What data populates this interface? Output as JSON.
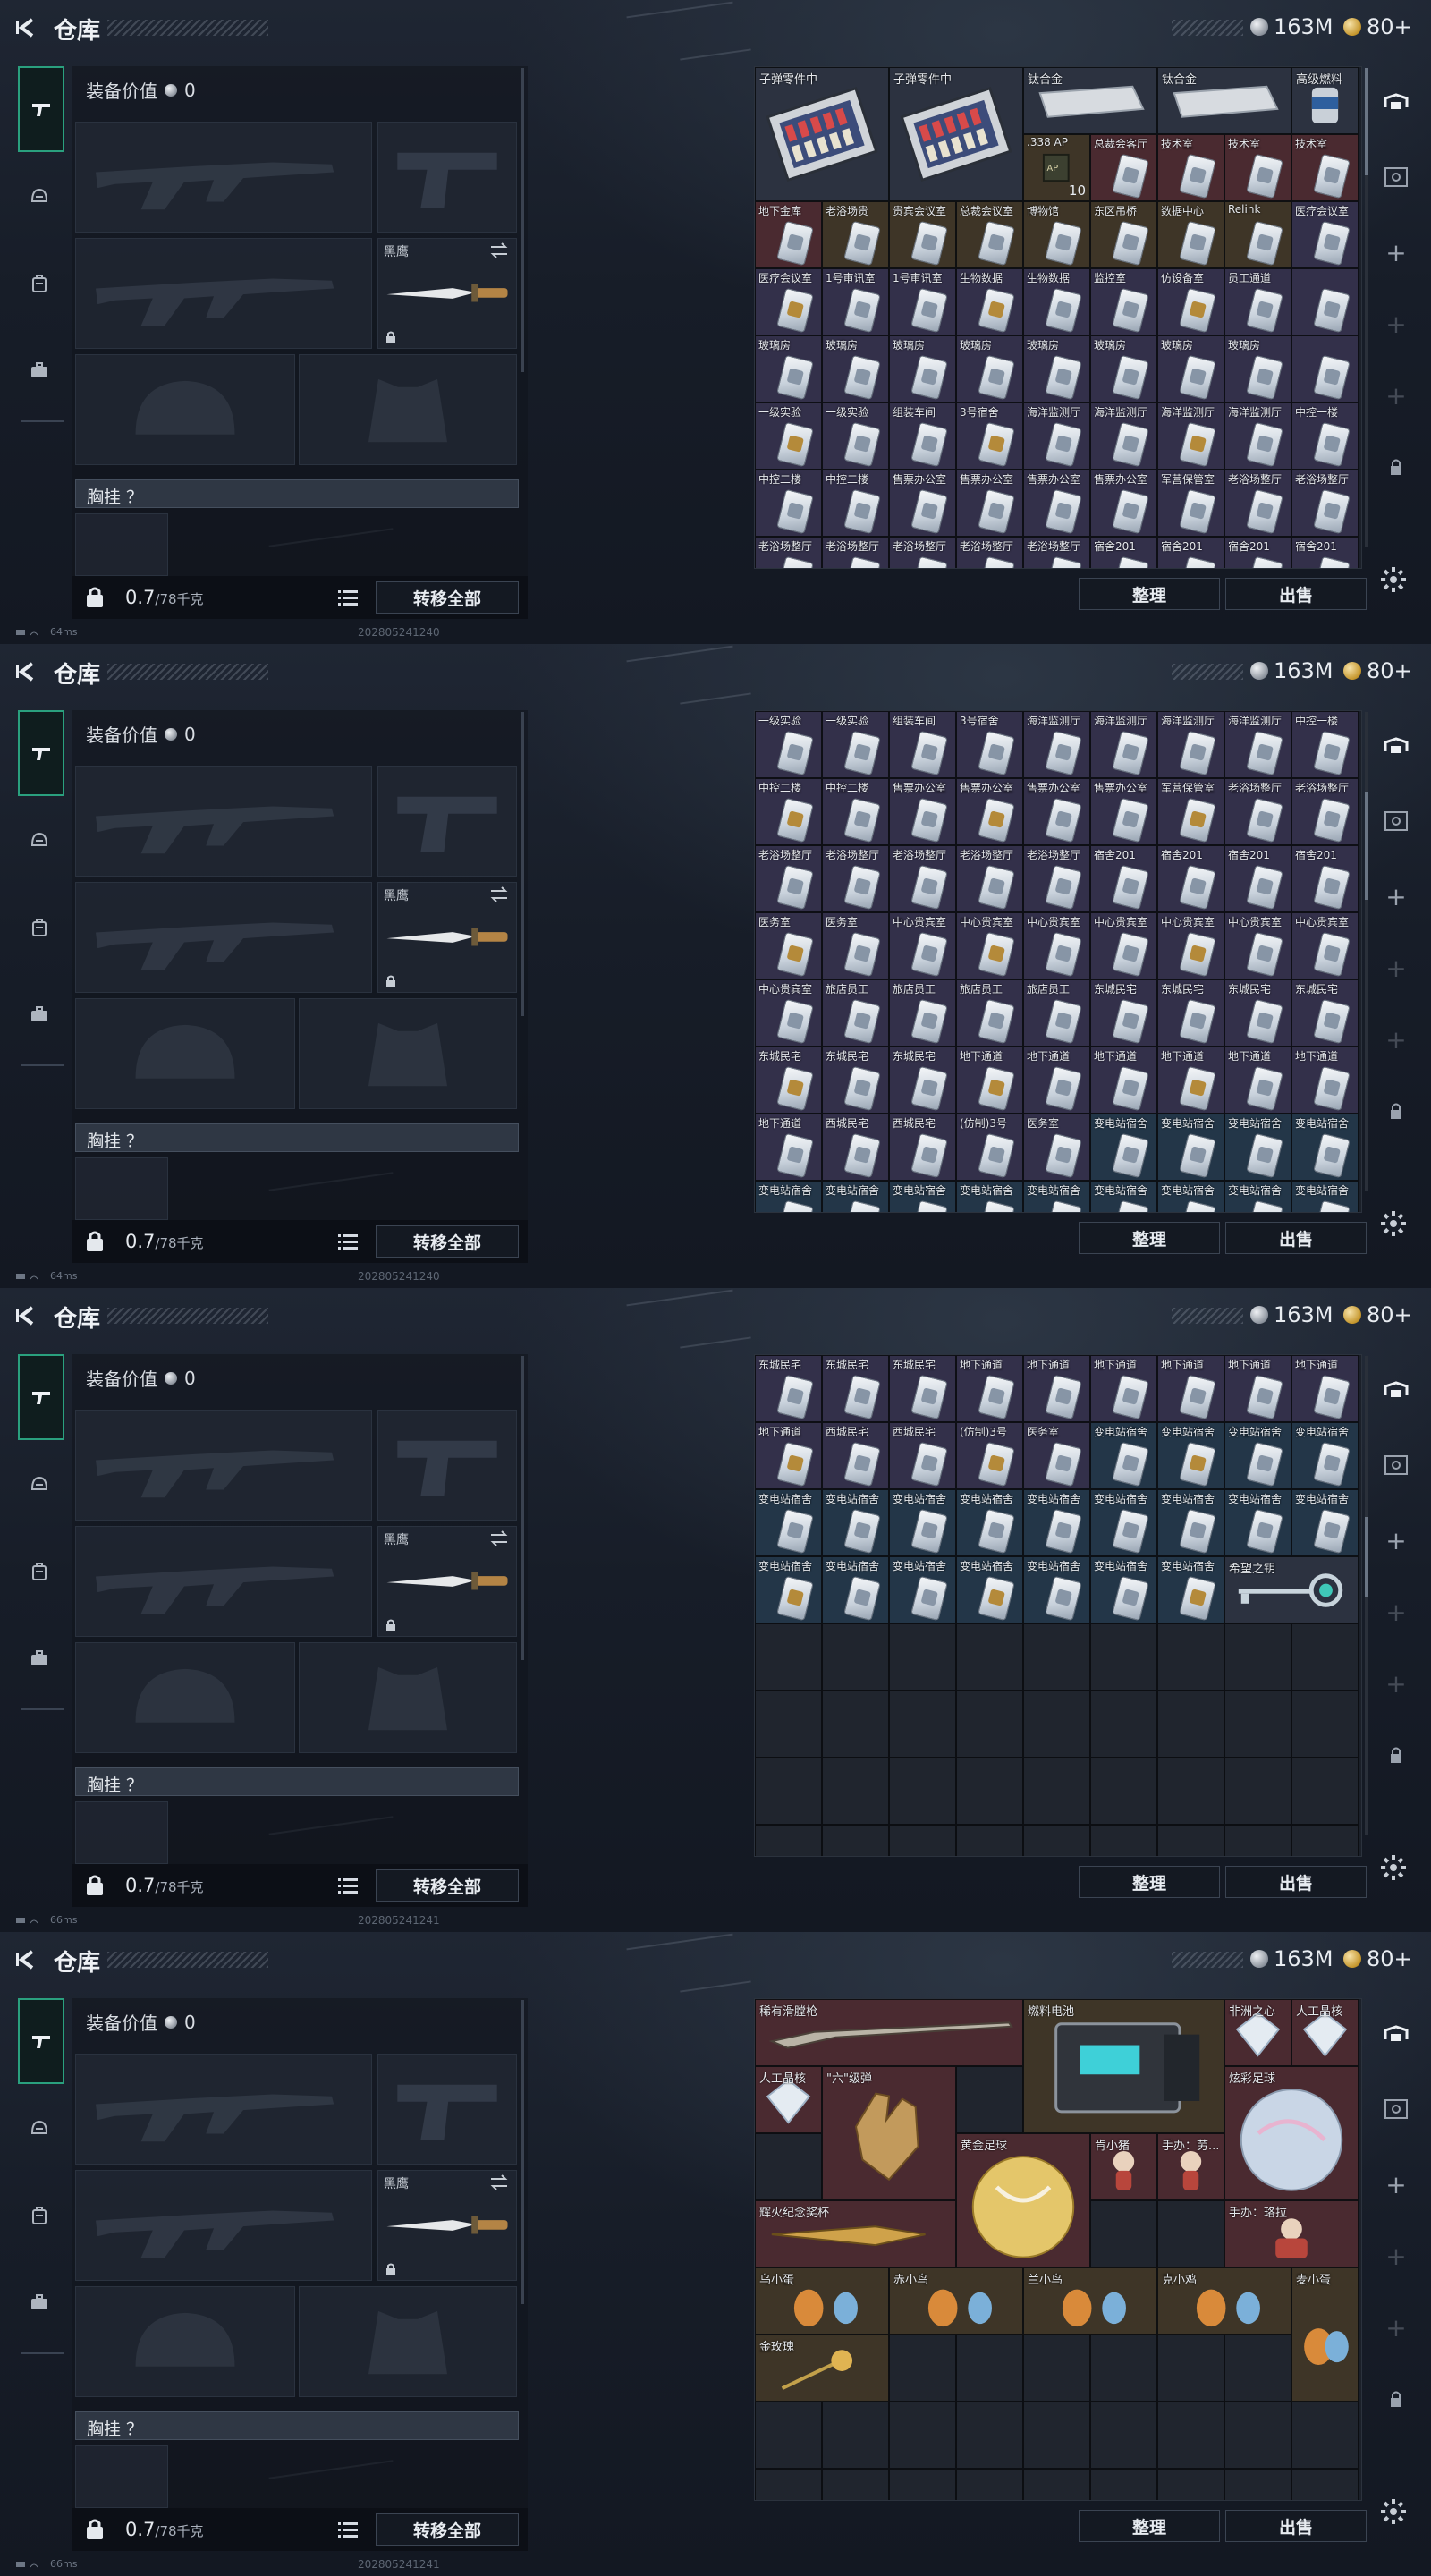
{
  "header": {
    "title": "仓库",
    "silver": "163M",
    "gold": "80+"
  },
  "equip": {
    "value_label": "装备价值",
    "value": "0",
    "melee_label": "黑鹰",
    "chest_label": "胸挂 ？",
    "weight": "0.7",
    "weight_cap": "/78千克",
    "transfer_all": "转移全部"
  },
  "actions": {
    "sort": "整理",
    "sell": "出售"
  },
  "panels": [
    {
      "status_ping": "64ms",
      "stamp": "202805241240",
      "big_items": [
        {
          "label": "子弹零件中",
          "col": 0,
          "row": 0,
          "w": 2,
          "h": 2,
          "kind": "box"
        },
        {
          "label": "子弹零件中",
          "col": 2,
          "row": 0,
          "w": 2,
          "h": 2,
          "kind": "box"
        },
        {
          "label": "钛合金",
          "col": 4,
          "row": 0,
          "w": 2,
          "h": 1,
          "kind": "plate"
        },
        {
          "label": "钛合金",
          "col": 6,
          "row": 0,
          "w": 2,
          "h": 1,
          "kind": "plate"
        },
        {
          "label": "高级燃料",
          "col": 8,
          "row": 0,
          "w": 1,
          "h": 1,
          "kind": "can"
        }
      ],
      "cells": [
        {
          "col": 4,
          "row": 1,
          "label": ".338 AP",
          "tone": "gold",
          "kind": "ammo",
          "qty": "10"
        },
        {
          "col": 5,
          "row": 1,
          "label": "总裁会客厅",
          "tone": "red",
          "kind": "card"
        },
        {
          "col": 6,
          "row": 1,
          "label": "技术室",
          "tone": "red",
          "kind": "card"
        },
        {
          "col": 7,
          "row": 1,
          "label": "技术室",
          "tone": "red",
          "kind": "card"
        },
        {
          "col": 8,
          "row": 1,
          "label": "技术室",
          "tone": "red",
          "kind": "card"
        }
      ],
      "rows": [
        {
          "start": 2,
          "tone": [
            "red",
            "gold",
            "gold",
            "gold",
            "gold",
            "gold",
            "gold",
            "gold",
            "purple"
          ],
          "labels": [
            "地下金库",
            "老浴场贵",
            "贵宾会议室",
            "总裁会议室",
            "博物馆",
            "东区吊桥",
            "数据中心",
            "Relink",
            "医疗会议室"
          ]
        },
        {
          "start": 3,
          "tone": [
            "purple",
            "purple",
            "purple",
            "purple",
            "purple",
            "purple",
            "purple",
            "purple",
            "purple"
          ],
          "labels": [
            "医疗会议室",
            "1号审讯室",
            "1号审讯室",
            "生物数据",
            "生物数据",
            "监控室",
            "仿设备室",
            "员工通道",
            ""
          ]
        },
        {
          "start": 4,
          "tone": [
            "purple",
            "purple",
            "purple",
            "purple",
            "purple",
            "purple",
            "purple",
            "purple",
            "purple"
          ],
          "labels": [
            "玻璃房",
            "玻璃房",
            "玻璃房",
            "玻璃房",
            "玻璃房",
            "玻璃房",
            "玻璃房",
            "玻璃房",
            ""
          ]
        },
        {
          "start": 5,
          "tone": [
            "purple",
            "purple",
            "purple",
            "purple",
            "purple",
            "purple",
            "purple",
            "purple",
            "purple"
          ],
          "labels": [
            "一级实验",
            "一级实验",
            "组装车间",
            "3号宿舍",
            "海洋监测厅",
            "海洋监测厅",
            "海洋监测厅",
            "海洋监测厅",
            "中控一楼"
          ]
        },
        {
          "start": 6,
          "tone": [
            "purple",
            "purple",
            "purple",
            "purple",
            "purple",
            "purple",
            "purple",
            "purple",
            "purple"
          ],
          "labels": [
            "中控二楼",
            "中控二楼",
            "售票办公室",
            "售票办公室",
            "售票办公室",
            "售票办公室",
            "军营保管室",
            "老浴场整厅",
            "老浴场整厅"
          ]
        },
        {
          "start": 7,
          "tone": [
            "purple",
            "purple",
            "purple",
            "purple",
            "purple",
            "purple",
            "purple",
            "purple",
            "purple"
          ],
          "labels": [
            "老浴场整厅",
            "老浴场整厅",
            "老浴场整厅",
            "老浴场整厅",
            "老浴场整厅",
            "宿舍201",
            "宿舍201",
            "宿舍201",
            "宿舍201"
          ]
        }
      ],
      "scroll_len": 120
    },
    {
      "status_ping": "64ms",
      "stamp": "202805241240",
      "big_items": [],
      "cells": [],
      "rows": [
        {
          "start": 0,
          "tone": [
            "purple",
            "purple",
            "purple",
            "purple",
            "purple",
            "purple",
            "purple",
            "purple",
            "purple"
          ],
          "labels": [
            "一级实验",
            "一级实验",
            "组装车间",
            "3号宿舍",
            "海洋监测厅",
            "海洋监测厅",
            "海洋监测厅",
            "海洋监测厅",
            "中控一楼"
          ]
        },
        {
          "start": 1,
          "tone": [
            "purple",
            "purple",
            "purple",
            "purple",
            "purple",
            "purple",
            "purple",
            "purple",
            "purple"
          ],
          "labels": [
            "中控二楼",
            "中控二楼",
            "售票办公室",
            "售票办公室",
            "售票办公室",
            "售票办公室",
            "军营保管室",
            "老浴场整厅",
            "老浴场整厅"
          ]
        },
        {
          "start": 2,
          "tone": [
            "purple",
            "purple",
            "purple",
            "purple",
            "purple",
            "purple",
            "purple",
            "purple",
            "purple"
          ],
          "labels": [
            "老浴场整厅",
            "老浴场整厅",
            "老浴场整厅",
            "老浴场整厅",
            "老浴场整厅",
            "宿舍201",
            "宿舍201",
            "宿舍201",
            "宿舍201"
          ]
        },
        {
          "start": 3,
          "tone": [
            "purple",
            "purple",
            "purple",
            "purple",
            "purple",
            "purple",
            "purple",
            "purple",
            "purple"
          ],
          "labels": [
            "医务室",
            "医务室",
            "中心贵宾室",
            "中心贵宾室",
            "中心贵宾室",
            "中心贵宾室",
            "中心贵宾室",
            "中心贵宾室",
            "中心贵宾室"
          ]
        },
        {
          "start": 4,
          "tone": [
            "purple",
            "purple",
            "purple",
            "purple",
            "purple",
            "purple",
            "purple",
            "purple",
            "purple"
          ],
          "labels": [
            "中心贵宾室",
            "旅店员工",
            "旅店员工",
            "旅店员工",
            "旅店员工",
            "东城民宅",
            "东城民宅",
            "东城民宅",
            "东城民宅"
          ]
        },
        {
          "start": 5,
          "tone": [
            "purple",
            "purple",
            "purple",
            "purple",
            "purple",
            "purple",
            "purple",
            "purple",
            "purple"
          ],
          "labels": [
            "东城民宅",
            "东城民宅",
            "东城民宅",
            "地下通道",
            "地下通道",
            "地下通道",
            "地下通道",
            "地下通道",
            "地下通道"
          ]
        },
        {
          "start": 6,
          "tone": [
            "purple",
            "purple",
            "purple",
            "purple",
            "purple",
            "blue",
            "blue",
            "blue",
            "blue"
          ],
          "labels": [
            "地下通道",
            "西城民宅",
            "西城民宅",
            "(仿制)3号",
            "医务室",
            "变电站宿舍",
            "变电站宿舍",
            "变电站宿舍",
            "变电站宿舍"
          ]
        },
        {
          "start": 7,
          "tone": [
            "blue",
            "blue",
            "blue",
            "blue",
            "blue",
            "blue",
            "blue",
            "blue",
            "blue"
          ],
          "labels": [
            "变电站宿舍",
            "变电站宿舍",
            "变电站宿舍",
            "变电站宿舍",
            "变电站宿舍",
            "变电站宿舍",
            "变电站宿舍",
            "变电站宿舍",
            "变电站宿舍"
          ]
        }
      ],
      "scroll_len": 120
    },
    {
      "status_ping": "66ms",
      "stamp": "202805241241",
      "big_items": [
        {
          "label": "希望之钥",
          "col": 7,
          "row": 3,
          "w": 2,
          "h": 1,
          "kind": "key"
        }
      ],
      "cells": [],
      "rows": [
        {
          "start": 0,
          "tone": [
            "purple",
            "purple",
            "purple",
            "purple",
            "purple",
            "purple",
            "purple",
            "purple",
            "purple"
          ],
          "labels": [
            "东城民宅",
            "东城民宅",
            "东城民宅",
            "地下通道",
            "地下通道",
            "地下通道",
            "地下通道",
            "地下通道",
            "地下通道"
          ]
        },
        {
          "start": 1,
          "tone": [
            "purple",
            "purple",
            "purple",
            "purple",
            "purple",
            "blue",
            "blue",
            "blue",
            "blue"
          ],
          "labels": [
            "地下通道",
            "西城民宅",
            "西城民宅",
            "(仿制)3号",
            "医务室",
            "变电站宿舍",
            "变电站宿舍",
            "变电站宿舍",
            "变电站宿舍"
          ]
        },
        {
          "start": 2,
          "tone": [
            "blue",
            "blue",
            "blue",
            "blue",
            "blue",
            "blue",
            "blue",
            "blue",
            "blue"
          ],
          "labels": [
            "变电站宿舍",
            "变电站宿舍",
            "变电站宿舍",
            "变电站宿舍",
            "变电站宿舍",
            "变电站宿舍",
            "变电站宿舍",
            "变电站宿舍",
            "变电站宿舍"
          ]
        },
        {
          "start": 3,
          "tone": [
            "blue",
            "blue",
            "blue",
            "blue",
            "blue",
            "blue",
            "blue",
            "",
            ""
          ],
          "labels": [
            "变电站宿舍",
            "变电站宿舍",
            "变电站宿舍",
            "变电站宿舍",
            "变电站宿舍",
            "变电站宿舍",
            "变电站宿舍",
            "",
            ""
          ]
        }
      ],
      "scroll_len": 90
    },
    {
      "status_ping": "66ms",
      "stamp": "202805241241",
      "big_items": [
        {
          "label": "稀有滑膛枪",
          "col": 0,
          "row": 0,
          "w": 4,
          "h": 1,
          "kind": "rifle",
          "tone": "red"
        },
        {
          "label": "燃料电池",
          "col": 4,
          "row": 0,
          "w": 3,
          "h": 2,
          "kind": "battery",
          "tone": "gold"
        },
        {
          "label": "非洲之心",
          "col": 7,
          "row": 0,
          "w": 1,
          "h": 1,
          "kind": "gem",
          "tone": "red"
        },
        {
          "label": "人工晶核",
          "col": 8,
          "row": 0,
          "w": 1,
          "h": 1,
          "kind": "gem",
          "tone": "red"
        },
        {
          "label": "人工晶核",
          "col": 0,
          "row": 1,
          "w": 1,
          "h": 1,
          "kind": "gem",
          "tone": "red"
        },
        {
          "label": "\"六\"级弹",
          "col": 1,
          "row": 1,
          "w": 2,
          "h": 2,
          "kind": "hand",
          "tone": "red"
        },
        {
          "label": "炫彩足球",
          "col": 7,
          "row": 1,
          "w": 2,
          "h": 2,
          "kind": "orb",
          "tone": "red"
        },
        {
          "label": "黄金足球",
          "col": 3,
          "row": 2,
          "w": 2,
          "h": 2,
          "kind": "ball",
          "tone": "red"
        },
        {
          "label": "肯小猪",
          "col": 5,
          "row": 2,
          "w": 1,
          "h": 1,
          "kind": "figure",
          "tone": "red"
        },
        {
          "label": "手办：劳...",
          "col": 6,
          "row": 2,
          "w": 1,
          "h": 1,
          "kind": "figure",
          "tone": "red"
        },
        {
          "label": "辉火纪念奖杯",
          "col": 0,
          "row": 3,
          "w": 3,
          "h": 1,
          "kind": "trophy",
          "tone": "red"
        },
        {
          "label": "手办：珞拉",
          "col": 7,
          "row": 3,
          "w": 2,
          "h": 1,
          "kind": "figure",
          "tone": "red"
        },
        {
          "label": "乌小蛋",
          "col": 0,
          "row": 4,
          "w": 2,
          "h": 1,
          "kind": "egg",
          "tone": "gold"
        },
        {
          "label": "赤小鸟",
          "col": 2,
          "row": 4,
          "w": 2,
          "h": 1,
          "kind": "egg",
          "tone": "gold"
        },
        {
          "label": "兰小鸟",
          "col": 4,
          "row": 4,
          "w": 2,
          "h": 1,
          "kind": "egg",
          "tone": "gold"
        },
        {
          "label": "克小鸡",
          "col": 6,
          "row": 4,
          "w": 2,
          "h": 1,
          "kind": "egg",
          "tone": "gold"
        },
        {
          "label": "麦小蛋",
          "col": 8,
          "row": 4,
          "w": 1,
          "h": 2,
          "kind": "egg",
          "tone": "gold"
        },
        {
          "label": "金玫瑰",
          "col": 0,
          "row": 5,
          "w": 2,
          "h": 1,
          "kind": "rose",
          "tone": "gold"
        }
      ],
      "cells": [],
      "rows": [],
      "scroll_len": 0
    }
  ],
  "colors": {
    "accent": "#2aa07e",
    "panel": "#1b2029"
  }
}
